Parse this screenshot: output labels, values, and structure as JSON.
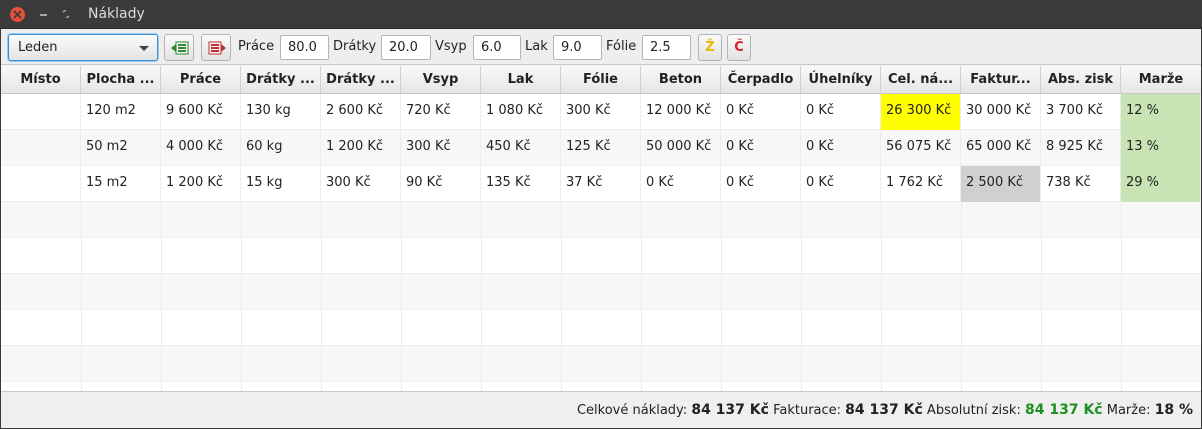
{
  "window": {
    "title": "Náklady"
  },
  "toolbar": {
    "month": "Leden",
    "fields": [
      {
        "label": "Práce",
        "value": "80.0"
      },
      {
        "label": "Drátky",
        "value": "20.0"
      },
      {
        "label": "Vsyp",
        "value": "6.0"
      },
      {
        "label": "Lak",
        "value": "9.0"
      },
      {
        "label": "Fólie",
        "value": "2.5"
      }
    ],
    "z_label": "Ž",
    "c_label": "Č",
    "z_color": "#e8b800",
    "c_color": "#e02020"
  },
  "table": {
    "headers": [
      "Místo",
      "Plocha ...",
      "Práce",
      "Drátky ...",
      "Drátky ...",
      "Vsyp",
      "Lak",
      "Fólie",
      "Beton",
      "Čerpadlo",
      "Úhelníky",
      "Cel. ná...",
      "Faktur...",
      "Abs. zisk",
      "Marže"
    ],
    "rows": [
      [
        "",
        "120 m2",
        "9 600 Kč",
        "130 kg",
        "2 600 Kč",
        "720 Kč",
        "1 080 Kč",
        "300 Kč",
        "12 000 Kč",
        "0 Kč",
        "0 Kč",
        "26 300 Kč",
        "30 000 Kč",
        "3 700 Kč",
        "12 %"
      ],
      [
        "",
        "50 m2",
        "4 000 Kč",
        "60 kg",
        "1 200 Kč",
        "300 Kč",
        "450 Kč",
        "125 Kč",
        "50 000 Kč",
        "0 Kč",
        "0 Kč",
        "56 075 Kč",
        "65 000 Kč",
        "8 925 Kč",
        "13 %"
      ],
      [
        "",
        "15 m2",
        "1 200 Kč",
        "15 kg",
        "300 Kč",
        "90 Kč",
        "135 Kč",
        "37 Kč",
        "0 Kč",
        "0 Kč",
        "0 Kč",
        "1 762 Kč",
        "2 500 Kč",
        "738 Kč",
        "29 %"
      ]
    ],
    "highlight_colors": {
      "yellow": "#ffff00",
      "green": "#c8e3b4",
      "gray": "#d0d0d0"
    }
  },
  "status": {
    "costs_label": "Celkové náklady:",
    "costs_value": "84 137 Kč",
    "billing_label": "Fakturace:",
    "billing_value": "84 137 Kč",
    "profit_label": "Absolutní zisk:",
    "profit_value": "84 137 Kč",
    "margin_label": "Marže:",
    "margin_value": "18 %"
  }
}
